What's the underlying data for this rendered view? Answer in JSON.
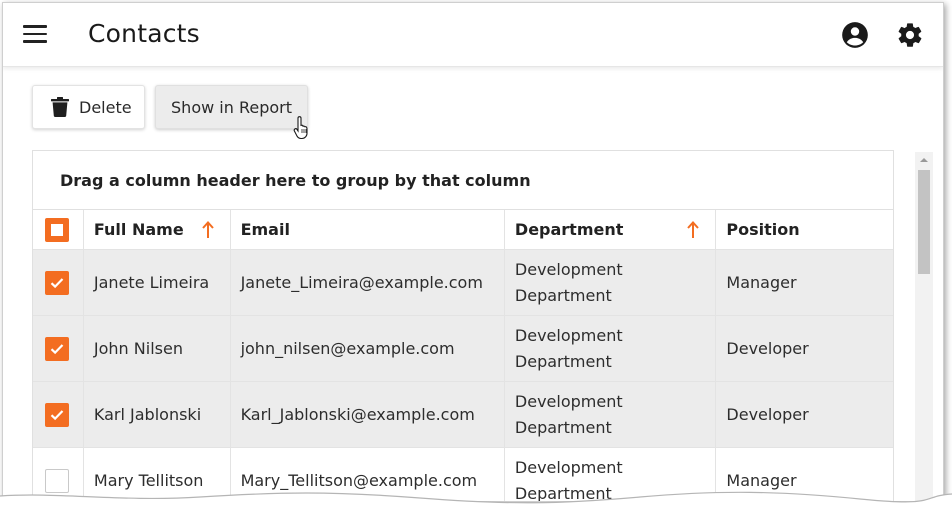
{
  "header": {
    "title": "Contacts",
    "menu_icon": "menu-icon",
    "account_icon": "account-circle-icon",
    "settings_icon": "gear-icon"
  },
  "toolbar": {
    "delete_label": "Delete",
    "report_label": "Show in Report"
  },
  "grid": {
    "group_hint": "Drag a column header here to group by that column",
    "columns": [
      "Full Name",
      "Email",
      "Department",
      "Position"
    ],
    "sorted_columns": [
      "Full Name",
      "Department"
    ],
    "rows": [
      {
        "selected": true,
        "name": "Janete Limeira",
        "email": "Janete_Limeira@example.com",
        "department": "Development Department",
        "position": "Manager"
      },
      {
        "selected": true,
        "name": "John Nilsen",
        "email": "john_nilsen@example.com",
        "department": "Development Department",
        "position": "Developer"
      },
      {
        "selected": true,
        "name": "Karl Jablonski",
        "email": "Karl_Jablonski@example.com",
        "department": "Development Department",
        "position": "Developer"
      },
      {
        "selected": false,
        "name": "Mary Tellitson",
        "email": "Mary_Tellitson@example.com",
        "department": "Development Department",
        "position": "Manager"
      }
    ]
  },
  "colors": {
    "accent": "#f36d21",
    "selected_row": "#ececec"
  }
}
